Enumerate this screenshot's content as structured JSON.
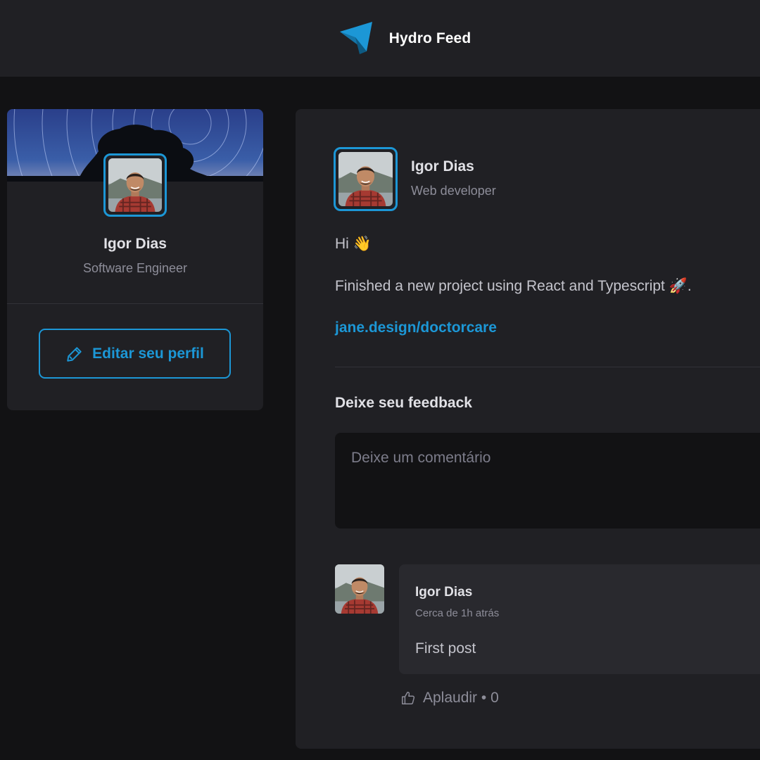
{
  "header": {
    "brand_name": "Hydro Feed",
    "logo_icon": "paper-plane-icon"
  },
  "sidebar": {
    "avatar_icon": "avatar-photo",
    "name": "Igor Dias",
    "role": "Software Engineer",
    "edit_button_label": "Editar seu perfil",
    "edit_icon": "pencil-icon"
  },
  "post": {
    "author": {
      "name": "Igor Dias",
      "role": "Web developer"
    },
    "content": {
      "line1": "Hi 👋",
      "line2": "Finished a new project using React and Typescript 🚀.",
      "link": "jane.design/doctorcare"
    },
    "feedback": {
      "title": "Deixe seu feedback",
      "placeholder": "Deixe um comentário"
    },
    "comments": [
      {
        "author": "Igor Dias",
        "time": "Cerca de 1h atrás",
        "text": "First post",
        "applaud_label": "Aplaudir • 0",
        "applaud_icon": "thumbs-up-icon"
      }
    ]
  },
  "colors": {
    "accent": "#1c97d6",
    "background": "#121214",
    "card": "#202024",
    "comment_bg": "#29292e"
  }
}
